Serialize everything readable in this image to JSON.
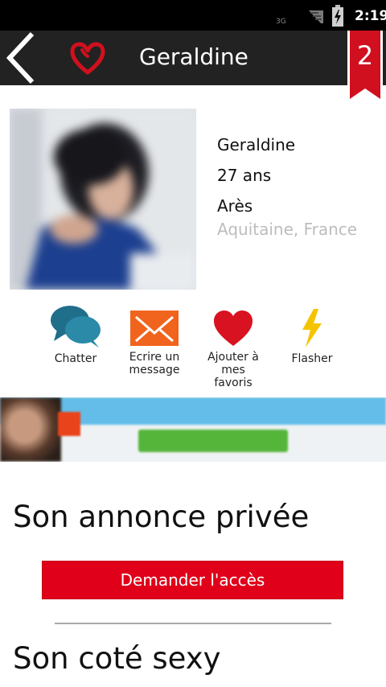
{
  "status_bar": {
    "network": "3G",
    "time": "2:19",
    "icons": [
      "signal-icon",
      "battery-charging-icon"
    ]
  },
  "header": {
    "title": "Geraldine",
    "badge_count": "2",
    "icons": [
      "back-chevron-icon",
      "heart-logo-icon",
      "ribbon-badge-icon"
    ]
  },
  "profile": {
    "name": "Geraldine",
    "age": "27 ans",
    "city": "Arès",
    "region": "Aquitaine, France"
  },
  "actions": [
    {
      "label": "Chatter",
      "icon": "chat-bubbles-icon"
    },
    {
      "label": "Ecrire un\nmessage",
      "icon": "envelope-icon"
    },
    {
      "label": "Ajouter à\nmes\nfavoris",
      "icon": "heart-icon"
    },
    {
      "label": "Flasher",
      "icon": "lightning-icon"
    }
  ],
  "sections": {
    "private_ad_title": "Son annonce privée",
    "request_access_label": "Demander l'accès",
    "sexy_side_title": "Son coté sexy"
  },
  "colors": {
    "accent_red": "#e0001a",
    "header_bg": "#222222",
    "chat_blue": "#1f7a94",
    "envelope_orange": "#f0641e",
    "bolt_yellow": "#f5c400"
  }
}
